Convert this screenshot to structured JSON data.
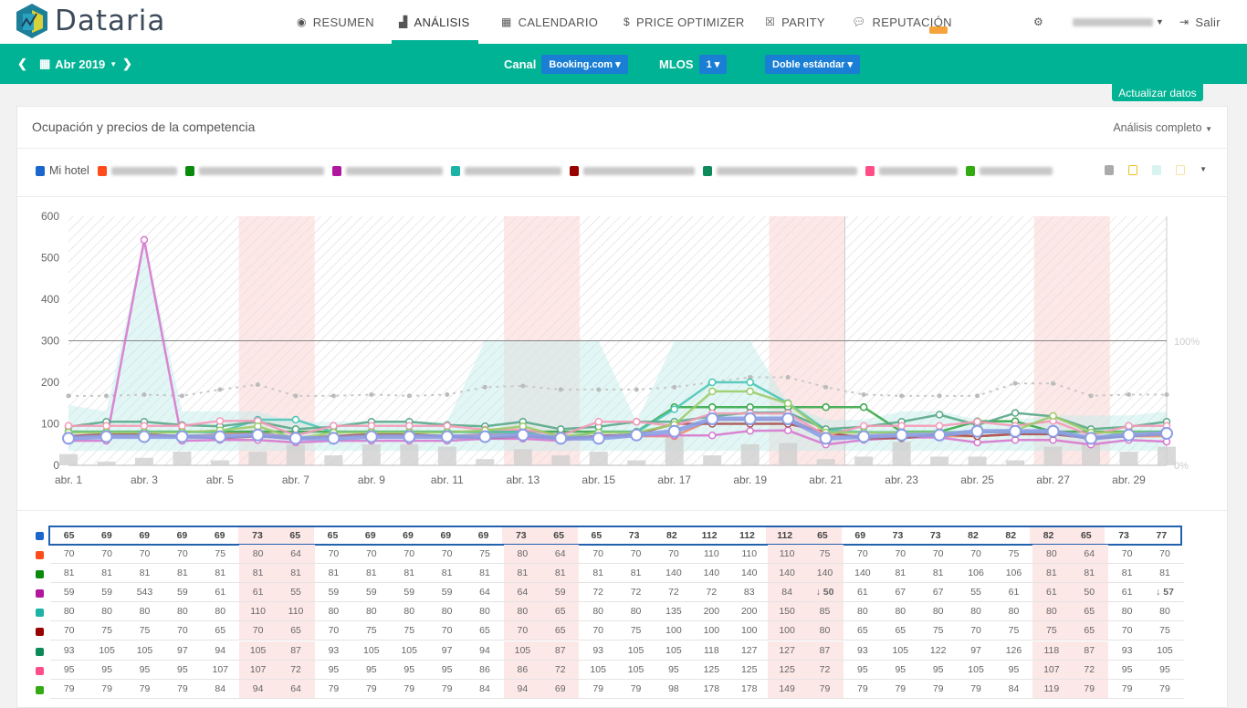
{
  "app": {
    "logo_text": "Dataria"
  },
  "nav": {
    "items": [
      {
        "label": "RESUMEN",
        "icon": "dashboard-icon"
      },
      {
        "label": "ANÁLISIS",
        "icon": "area-chart-icon",
        "active": true
      },
      {
        "label": "CALENDARIO",
        "icon": "calendar-icon"
      },
      {
        "label": "PRICE OPTIMIZER",
        "icon": "dollar-icon"
      },
      {
        "label": "PARITY",
        "icon": "close-box-icon"
      },
      {
        "label": "REPUTACIÓN",
        "icon": "comments-icon"
      }
    ],
    "logout": "Salir"
  },
  "toolbar": {
    "month": "Abr 2019",
    "canal_label": "Canal",
    "canal_value": "Booking.com",
    "mlos_label": "MLOS",
    "mlos_value": "1",
    "room_value": "Doble estándar",
    "update": "Actualizar datos"
  },
  "card": {
    "title": "Ocupación y precios de la competencia",
    "menu": "Análisis completo"
  },
  "legend": {
    "my_hotel": "Mi hotel"
  },
  "colors": {
    "accent": "#00b394",
    "primary": "#1a7fd4",
    "weekend": "#fde8e8"
  },
  "chart_data": {
    "type": "line",
    "x": [
      1,
      2,
      3,
      4,
      5,
      6,
      7,
      8,
      9,
      10,
      11,
      12,
      13,
      14,
      15,
      16,
      17,
      18,
      19,
      20,
      21,
      22,
      23,
      24,
      25,
      26,
      27,
      28,
      29,
      30
    ],
    "x_tick_labels": [
      "abr. 1",
      "abr. 3",
      "abr. 5",
      "abr. 7",
      "abr. 9",
      "abr. 11",
      "abr. 13",
      "abr. 15",
      "abr. 17",
      "abr. 19",
      "abr. 21",
      "abr. 23",
      "abr. 25",
      "abr. 27",
      "abr. 29"
    ],
    "y_ticks": [
      0,
      100,
      200,
      300,
      400,
      500,
      600
    ],
    "ylim": [
      0,
      600
    ],
    "y2_ticks": [
      "0%",
      "100%"
    ],
    "weekend_days": [
      6,
      7,
      13,
      14,
      20,
      21,
      27,
      28
    ],
    "series": [
      {
        "name": "Mi hotel",
        "color": "#1a66cc",
        "line": "#8c9ee6",
        "values": [
          65,
          69,
          69,
          69,
          69,
          73,
          65,
          65,
          69,
          69,
          69,
          69,
          73,
          65,
          65,
          73,
          82,
          112,
          112,
          112,
          65,
          69,
          73,
          73,
          82,
          82,
          82,
          65,
          73,
          77
        ]
      },
      {
        "color": "#ff4a1a",
        "line": "#f08a6a",
        "values": [
          70,
          70,
          70,
          70,
          75,
          80,
          64,
          70,
          70,
          70,
          70,
          75,
          80,
          64,
          70,
          70,
          70,
          110,
          110,
          110,
          75,
          70,
          70,
          70,
          70,
          75,
          80,
          64,
          70,
          70
        ]
      },
      {
        "color": "#0a8a0a",
        "line": "#3aa84a",
        "values": [
          81,
          81,
          81,
          81,
          81,
          81,
          81,
          81,
          81,
          81,
          81,
          81,
          81,
          81,
          81,
          81,
          140,
          140,
          140,
          140,
          140,
          140,
          81,
          81,
          106,
          106,
          81,
          81,
          81,
          81
        ]
      },
      {
        "color": "#b0179e",
        "line": "#d878cf",
        "values": [
          59,
          59,
          543,
          59,
          61,
          61,
          55,
          59,
          59,
          59,
          59,
          64,
          64,
          59,
          72,
          72,
          72,
          72,
          83,
          84,
          50,
          61,
          67,
          67,
          55,
          61,
          61,
          50,
          61,
          57
        ],
        "down_days": [
          21,
          30
        ]
      },
      {
        "color": "#1ab3a6",
        "line": "#4cc6b8",
        "values": [
          80,
          80,
          80,
          80,
          80,
          110,
          110,
          80,
          80,
          80,
          80,
          80,
          80,
          65,
          80,
          80,
          135,
          200,
          200,
          150,
          85,
          80,
          80,
          80,
          80,
          80,
          80,
          65,
          80,
          80
        ]
      },
      {
        "color": "#990000",
        "line": "#a85050",
        "values": [
          70,
          75,
          75,
          70,
          65,
          70,
          65,
          70,
          75,
          75,
          70,
          65,
          70,
          65,
          70,
          75,
          100,
          100,
          100,
          100,
          80,
          65,
          65,
          75,
          70,
          75,
          75,
          65,
          70,
          75
        ]
      },
      {
        "color": "#0d8a5a",
        "line": "#5aa88a",
        "values": [
          93,
          105,
          105,
          97,
          94,
          105,
          87,
          93,
          105,
          105,
          97,
          94,
          105,
          87,
          93,
          105,
          105,
          118,
          127,
          127,
          87,
          93,
          105,
          122,
          97,
          126,
          118,
          87,
          93,
          105
        ]
      },
      {
        "color": "#ff4d88",
        "line": "#f59ab8",
        "values": [
          95,
          95,
          95,
          95,
          107,
          107,
          72,
          95,
          95,
          95,
          95,
          86,
          86,
          72,
          105,
          105,
          95,
          125,
          125,
          125,
          72,
          95,
          95,
          95,
          105,
          95,
          107,
          72,
          95,
          95
        ]
      },
      {
        "color": "#33aa11",
        "line": "#9ccc6a",
        "values": [
          79,
          79,
          79,
          79,
          84,
          94,
          64,
          79,
          79,
          79,
          79,
          84,
          94,
          69,
          79,
          79,
          98,
          178,
          178,
          149,
          79,
          79,
          79,
          79,
          79,
          84,
          119,
          79,
          79,
          79
        ]
      }
    ],
    "occupancy_pct": [
      9,
      3,
      6,
      11,
      4,
      11,
      17,
      8,
      17,
      17,
      15,
      5,
      13,
      8,
      11,
      4,
      23,
      8,
      17,
      18,
      5,
      7,
      19,
      7,
      7,
      4,
      15,
      17,
      11,
      15
    ],
    "market_occupancy_pct": [
      56,
      56,
      57,
      56,
      61,
      65,
      56,
      56,
      57,
      56,
      57,
      63,
      64,
      61,
      61,
      61,
      63,
      67,
      71,
      71,
      63,
      57,
      56,
      56,
      56,
      66,
      66,
      56,
      57,
      57
    ],
    "demand_band_upper": [
      145,
      130,
      545,
      130,
      130,
      130,
      105,
      105,
      105,
      105,
      105,
      300,
      300,
      300,
      300,
      105,
      300,
      300,
      300,
      150,
      110,
      110,
      130,
      130,
      110,
      110,
      120,
      120,
      120,
      130
    ]
  }
}
